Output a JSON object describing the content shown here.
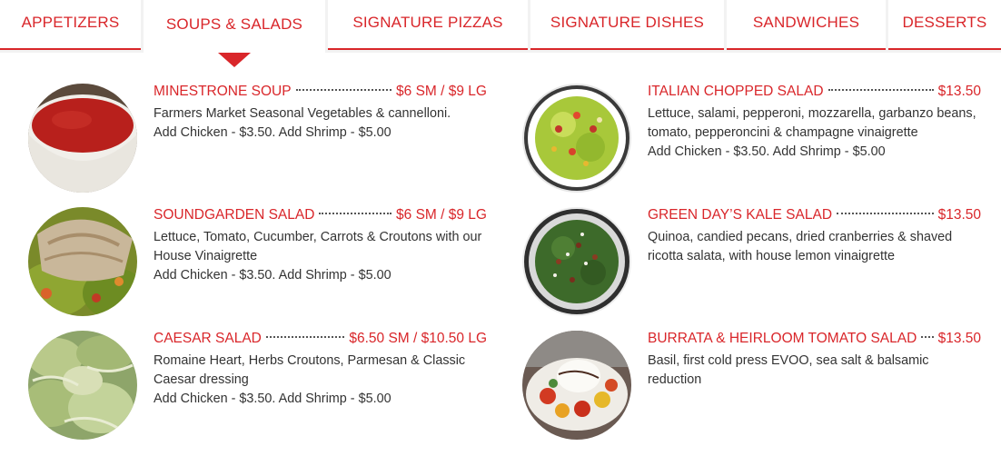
{
  "tabs": [
    {
      "label": "APPETIZERS",
      "active": false
    },
    {
      "label": "SOUPS & SALADS",
      "active": true
    },
    {
      "label": "SIGNATURE PIZZAS",
      "active": false
    },
    {
      "label": "SIGNATURE DISHES",
      "active": false
    },
    {
      "label": "SANDWICHES",
      "active": false
    },
    {
      "label": "DESSERTS",
      "active": false
    }
  ],
  "menu": {
    "left": [
      {
        "name": "MINESTRONE SOUP",
        "price": "$6 SM / $9 LG",
        "desc": "Farmers Market Seasonal Vegetables & cannelloni.",
        "addon": "Add Chicken - $3.50. Add Shrimp - $5.00",
        "image": "minestrone-soup-photo"
      },
      {
        "name": "SOUNDGARDEN SALAD",
        "price": "$6 SM / $9 LG",
        "desc": "Lettuce, Tomato, Cucumber, Carrots & Croutons with our House Vinaigrette",
        "addon": "Add Chicken - $3.50. Add Shrimp - $5.00",
        "image": "soundgarden-salad-photo"
      },
      {
        "name": "CAESAR SALAD",
        "price": "$6.50 SM / $10.50 LG",
        "desc": "Romaine Heart, Herbs Croutons, Parmesan & Classic Caesar dressing",
        "addon": "Add Chicken - $3.50. Add Shrimp - $5.00",
        "image": "caesar-salad-photo"
      }
    ],
    "right": [
      {
        "name": "ITALIAN CHOPPED SALAD",
        "price": "$13.50",
        "desc": "Lettuce, salami, pepperoni, mozzarella, garbanzo beans, tomato, pepperoncini & champagne vinaigrette",
        "addon": "Add Chicken - $3.50. Add Shrimp - $5.00",
        "image": "italian-chopped-salad-photo"
      },
      {
        "name": "GREEN DAY’S KALE SALAD",
        "price": "$13.50",
        "desc": "Quinoa, candied pecans, dried cranberries & shaved ricotta salata, with house lemon vinaigrette",
        "addon": "",
        "image": "kale-salad-photo"
      },
      {
        "name": "BURRATA & HEIRLOOM TOMATO SALAD",
        "price": "$13.50",
        "desc": "Basil, first cold press EVOO, sea salt & balsamic reduction",
        "addon": "",
        "image": "burrata-salad-photo"
      }
    ]
  },
  "colors": {
    "accent": "#d9262a",
    "text": "#333333",
    "tab_gap": "#f2f2f2"
  }
}
